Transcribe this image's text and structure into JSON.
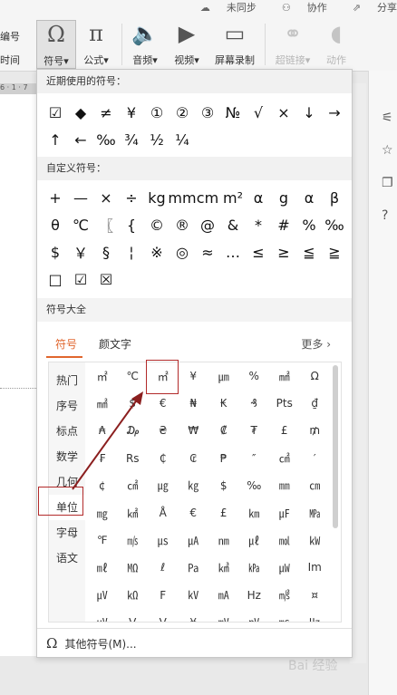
{
  "topbar": [
    "未同步",
    "协作",
    "分享"
  ],
  "left_labels": [
    "编号",
    "时间"
  ],
  "ribbon": {
    "symbol": {
      "icon": "Ω",
      "label": "符号"
    },
    "formula": {
      "icon": "π",
      "label": "公式"
    },
    "audio": {
      "label": "音频"
    },
    "video": {
      "label": "视频"
    },
    "record": {
      "label": "屏幕录制"
    },
    "hyperlink": {
      "label": "超链接"
    },
    "action": {
      "label": "动作"
    }
  },
  "ruler_text": "6 · 1 · 7",
  "dropdown": {
    "recent_title": "近期使用的符号：",
    "recent": [
      "☑",
      "◆",
      "≠",
      "¥",
      "①",
      "②",
      "③",
      "№",
      "√",
      "×",
      "↓",
      "→",
      "↑",
      "←",
      "‰",
      "¾",
      "½",
      "¼"
    ],
    "custom_title": "自定义符号：",
    "custom": [
      "+",
      "—",
      "×",
      "÷",
      "kg",
      "mm",
      "cm",
      "m²",
      "α",
      "g",
      "α",
      "β",
      "θ",
      "℃",
      "〖",
      "{",
      "©",
      "®",
      "@",
      "&",
      "*",
      "#",
      "%",
      "‰",
      "$",
      "￥",
      "§",
      "¦",
      "※",
      "◎",
      "≈",
      "…",
      "≤",
      "≥",
      "≦",
      "≧",
      "□",
      "☑",
      "☒"
    ],
    "all_title": "符号大全",
    "tabs": [
      "符号",
      "颜文字"
    ],
    "more": "更多",
    "categories": [
      "热门",
      "序号",
      "标点",
      "数学",
      "几何",
      "单位",
      "字母",
      "语文"
    ],
    "unit_symbols": [
      "㎡",
      "℃",
      "㎡",
      "¥",
      "㎛",
      "%",
      "㎟",
      "Ω",
      "㎟",
      "$",
      "€",
      "₦",
      "₭",
      "₰",
      "Pts",
      "₫",
      "₳",
      "₯",
      "₴",
      "₩",
      "₡",
      "₮",
      "£",
      "₥",
      "₣",
      "Rs",
      "₵",
      "₢",
      "₱",
      "″",
      "㎠",
      "′",
      "¢",
      "㎠",
      "㎍",
      "㎏",
      "$",
      "‰",
      "㎜",
      "㎝",
      "㎎",
      "㎢",
      "Å",
      "€",
      "£",
      "㎞",
      "㎌",
      "㎫",
      "℉",
      "㎧",
      "㎲",
      "㎂",
      "㎚",
      "㎕",
      "㏖",
      "㎾",
      "㎖",
      "㏁",
      "ℓ",
      "㎩",
      "㎦",
      "㎪",
      "㎼",
      "Im",
      "㎶",
      "㏀",
      "F",
      "㎸",
      "㎃",
      "Hz",
      "㎨",
      "¤",
      "㎶",
      "V",
      "V",
      "¥",
      "㎷",
      "㎴",
      "㎳",
      "㎐"
    ],
    "footer_icon": "Ω",
    "footer": "其他符号(M)..."
  },
  "watermark": "Bai 经验"
}
